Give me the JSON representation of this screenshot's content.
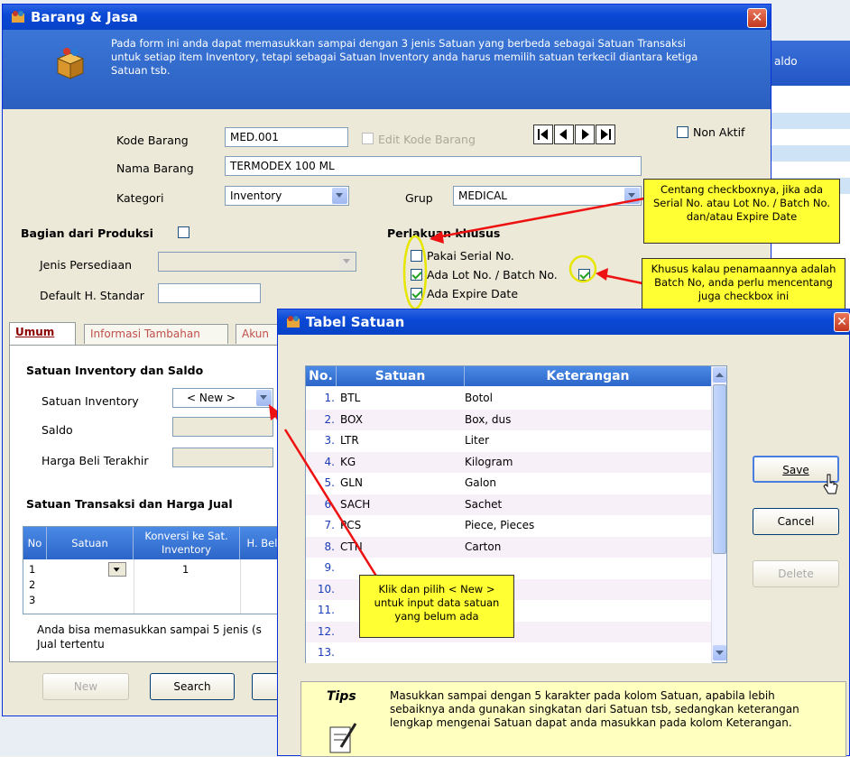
{
  "background": {
    "right_panel_header": "aldo"
  },
  "barang_window": {
    "title": "Barang & Jasa",
    "info_text": "Pada form ini anda dapat memasukkan sampai dengan 3 jenis Satuan yang berbeda sebagai Satuan Transaksi untuk setiap item Inventory, tetapi sebagai Satuan Inventory anda harus memilih satuan terkecil diantara ketiga Satuan tsb.",
    "kode_barang_label": "Kode Barang",
    "kode_barang_value": "MED.001",
    "edit_kode_label": "Edit Kode Barang",
    "non_aktif_label": "Non Aktif",
    "nama_barang_label": "Nama Barang",
    "nama_barang_value": "TERMODEX 100 ML",
    "kategori_label": "Kategori",
    "kategori_value": "Inventory",
    "grup_label": "Grup",
    "grup_value": "MEDICAL",
    "bagian_produksi_label": "Bagian dari Produksi",
    "jenis_persediaan_label": "Jenis Persediaan",
    "default_standar_label": "Default H. Standar",
    "perlakuan_khusus_label": "Perlakuan khusus",
    "pakai_serial_label": "Pakai Serial No.",
    "lot_batch_label": "Ada Lot No. / Batch No.",
    "expire_label": "Ada Expire Date",
    "tabs": [
      "Umum",
      "Informasi Tambahan",
      "Akun"
    ],
    "satuan_inventory_section": "Satuan Inventory dan Saldo",
    "satuan_inventory_label": "Satuan Inventory",
    "satuan_inventory_value": "< New >",
    "saldo_label": "Saldo",
    "harga_beli_label": "Harga Beli Terakhir",
    "satuan_transaksi_section": "Satuan Transaksi dan Harga Jual",
    "grid_headers": [
      "No",
      "Satuan",
      "Konversi ke Sat. Inventory",
      "H. Bel"
    ],
    "grid_rows": [
      {
        "no": "1",
        "konversi": "1"
      },
      {
        "no": "2",
        "konversi": ""
      },
      {
        "no": "3",
        "konversi": ""
      }
    ],
    "note_text_1": "Anda bisa memasukkan sampai 5 jenis (s",
    "note_text_2": "Jual tertentu",
    "new_button": "New",
    "search_button": "Search"
  },
  "callouts": {
    "checkbox_note": "Centang checkboxnya, jika ada Serial No. atau Lot No. / Batch No. dan/atau Expire Date",
    "batch_note": "Khusus kalau penamaannya adalah Batch No, anda perlu mencentang juga checkbox ini",
    "new_note": "Klik dan pilih < New > untuk input data satuan yang belum ada"
  },
  "satuan_window": {
    "title": "Tabel Satuan",
    "headers": [
      "No.",
      "Satuan",
      "Keterangan"
    ],
    "rows": [
      {
        "no": "1.",
        "satuan": "BTL",
        "keterangan": "Botol"
      },
      {
        "no": "2.",
        "satuan": "BOX",
        "keterangan": "Box, dus"
      },
      {
        "no": "3.",
        "satuan": "LTR",
        "keterangan": "Liter"
      },
      {
        "no": "4.",
        "satuan": "KG",
        "keterangan": "Kilogram"
      },
      {
        "no": "5.",
        "satuan": "GLN",
        "keterangan": "Galon"
      },
      {
        "no": "6.",
        "satuan": "SACH",
        "keterangan": "Sachet"
      },
      {
        "no": "7.",
        "satuan": "PCS",
        "keterangan": "Piece, Pieces"
      },
      {
        "no": "8.",
        "satuan": "CTN",
        "keterangan": "Carton"
      },
      {
        "no": "9.",
        "satuan": "",
        "keterangan": ""
      },
      {
        "no": "10.",
        "satuan": "",
        "keterangan": ""
      },
      {
        "no": "11.",
        "satuan": "",
        "keterangan": ""
      },
      {
        "no": "12.",
        "satuan": "",
        "keterangan": ""
      },
      {
        "no": "13.",
        "satuan": "",
        "keterangan": ""
      }
    ],
    "save_button": "Save",
    "cancel_button": "Cancel",
    "delete_button": "Delete",
    "tips_title": "Tips",
    "tips_text": "Masukkan sampai dengan 5 karakter pada kolom Satuan, apabila lebih sebaiknya anda gunakan singkatan dari Satuan tsb, sedangkan keterangan lengkap mengenai Satuan dapat anda masukkan pada kolom Keterangan."
  },
  "colors": {
    "title_blue": "#0a49d6",
    "callout_yellow": "#ffff33",
    "arrow_red": "#ee1111"
  }
}
